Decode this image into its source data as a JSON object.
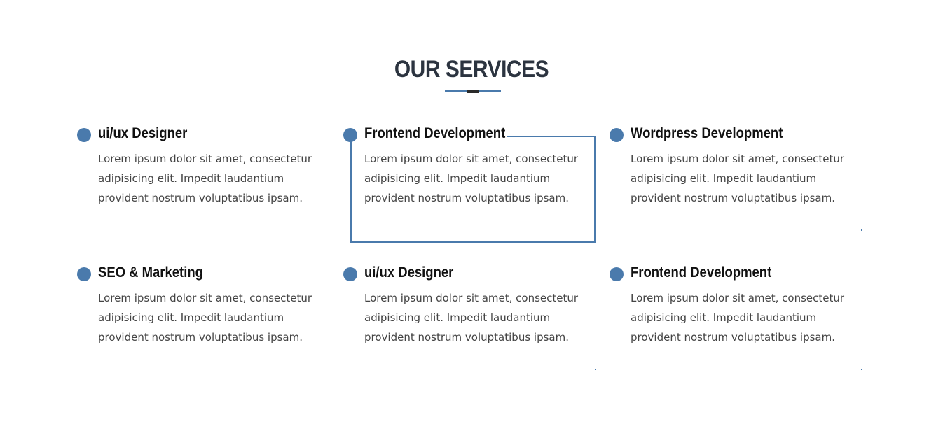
{
  "section": {
    "title": "OUR SERVICES"
  },
  "accent_color": "#4a7aac",
  "services": [
    {
      "title": "ui/ux Designer",
      "text": "Lorem ipsum dolor sit amet, consectetur adipisicing elit. Impedit laudantium provident nostrum voluptatibus ipsam."
    },
    {
      "title": "Frontend Development",
      "text": "Lorem ipsum dolor sit amet, consectetur adipisicing elit. Impedit laudantium provident nostrum voluptatibus ipsam."
    },
    {
      "title": "Wordpress Development",
      "text": "Lorem ipsum dolor sit amet, consectetur adipisicing elit. Impedit laudantium provident nostrum voluptatibus ipsam."
    },
    {
      "title": "SEO & Marketing",
      "text": "Lorem ipsum dolor sit amet, consectetur adipisicing elit. Impedit laudantium provident nostrum voluptatibus ipsam."
    },
    {
      "title": "ui/ux Designer",
      "text": "Lorem ipsum dolor sit amet, consectetur adipisicing elit. Impedit laudantium provident nostrum voluptatibus ipsam."
    },
    {
      "title": "Frontend Development",
      "text": "Lorem ipsum dolor sit amet, consectetur adipisicing elit. Impedit laudantium provident nostrum voluptatibus ipsam."
    }
  ]
}
